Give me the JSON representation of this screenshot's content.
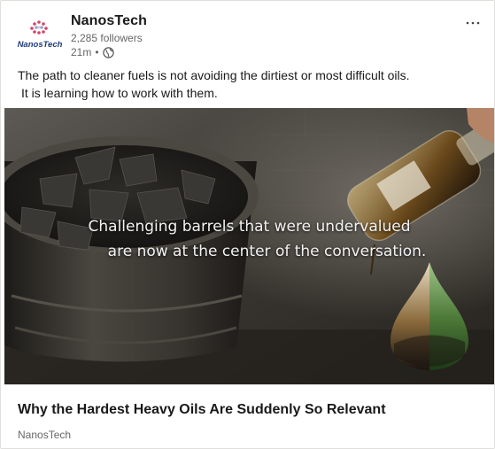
{
  "post": {
    "author": "NanosTech",
    "logo_text": "NanosTech",
    "followers": "2,285 followers",
    "time": "21m",
    "dot": "•",
    "more_icon": "ellipsis-icon",
    "text_line1": "The path to cleaner fuels is not avoiding the dirtiest or most difficult oils.",
    "text_line2": "It is learning how to work with them."
  },
  "image": {
    "overlay_line1": "Challenging barrels that were undervalued",
    "overlay_line2": "are now at the center of the conversation."
  },
  "link_preview": {
    "title": "Why the Hardest Heavy Oils Are Suddenly So Relevant",
    "source": "NanosTech"
  },
  "colors": {
    "accent_logo_red": "#d5446a",
    "accent_logo_blue": "#1f3b7a",
    "text_primary": "#191919",
    "text_secondary": "#666666"
  }
}
